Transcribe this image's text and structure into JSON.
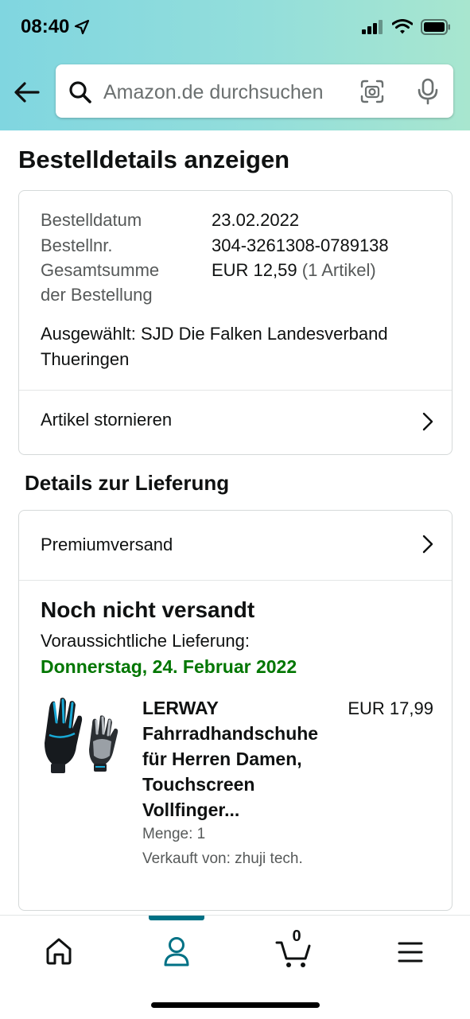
{
  "status_bar": {
    "time": "08:40",
    "icons": [
      "location-arrow-icon",
      "cellular-signal-icon",
      "wifi-icon",
      "battery-icon"
    ]
  },
  "header": {
    "search_placeholder": "Amazon.de durchsuchen",
    "icons": [
      "back-arrow-icon",
      "search-icon",
      "camera-scan-icon",
      "microphone-icon"
    ]
  },
  "page": {
    "title": "Bestelldetails anzeigen"
  },
  "order_summary": {
    "date_label": "Bestelldatum",
    "date_value": "23.02.2022",
    "number_label": "Bestellnr.",
    "number_value": "304-3261308-0789138",
    "total_label_line1": "Gesamtsumme",
    "total_label_line2": "der Bestellung",
    "total_amount": "EUR 12,59",
    "total_items": "(1 Artikel)",
    "selected": "Ausgewählt: SJD Die Falken Landesverband Thueringen",
    "cancel_label": "Artikel stornieren"
  },
  "delivery": {
    "section_title": "Details zur Lieferung",
    "shipping_method": "Premiumversand",
    "status": "Noch nicht versandt",
    "expected_label": "Voraussichtliche Lieferung:",
    "expected_date": "Donnerstag, 24. Februar 2022",
    "item": {
      "title": "LERWAY Fahrradhandschuhe für Herren Damen, Touchscreen Vollfinger...",
      "price": "EUR 17,99",
      "quantity": "Menge: 1",
      "seller": "Verkauft von: zhuji tech."
    }
  },
  "tab_bar": {
    "active_tab": "account",
    "cart_count": "0",
    "accent_color": "#007185",
    "tabs": [
      "home-icon",
      "account-icon",
      "cart-icon",
      "menu-icon"
    ]
  },
  "colors": {
    "header_gradient_start": "#80d6e0",
    "header_gradient_end": "#a8e6cf",
    "delivery_date_green": "#007600",
    "secondary_text": "#565959"
  }
}
